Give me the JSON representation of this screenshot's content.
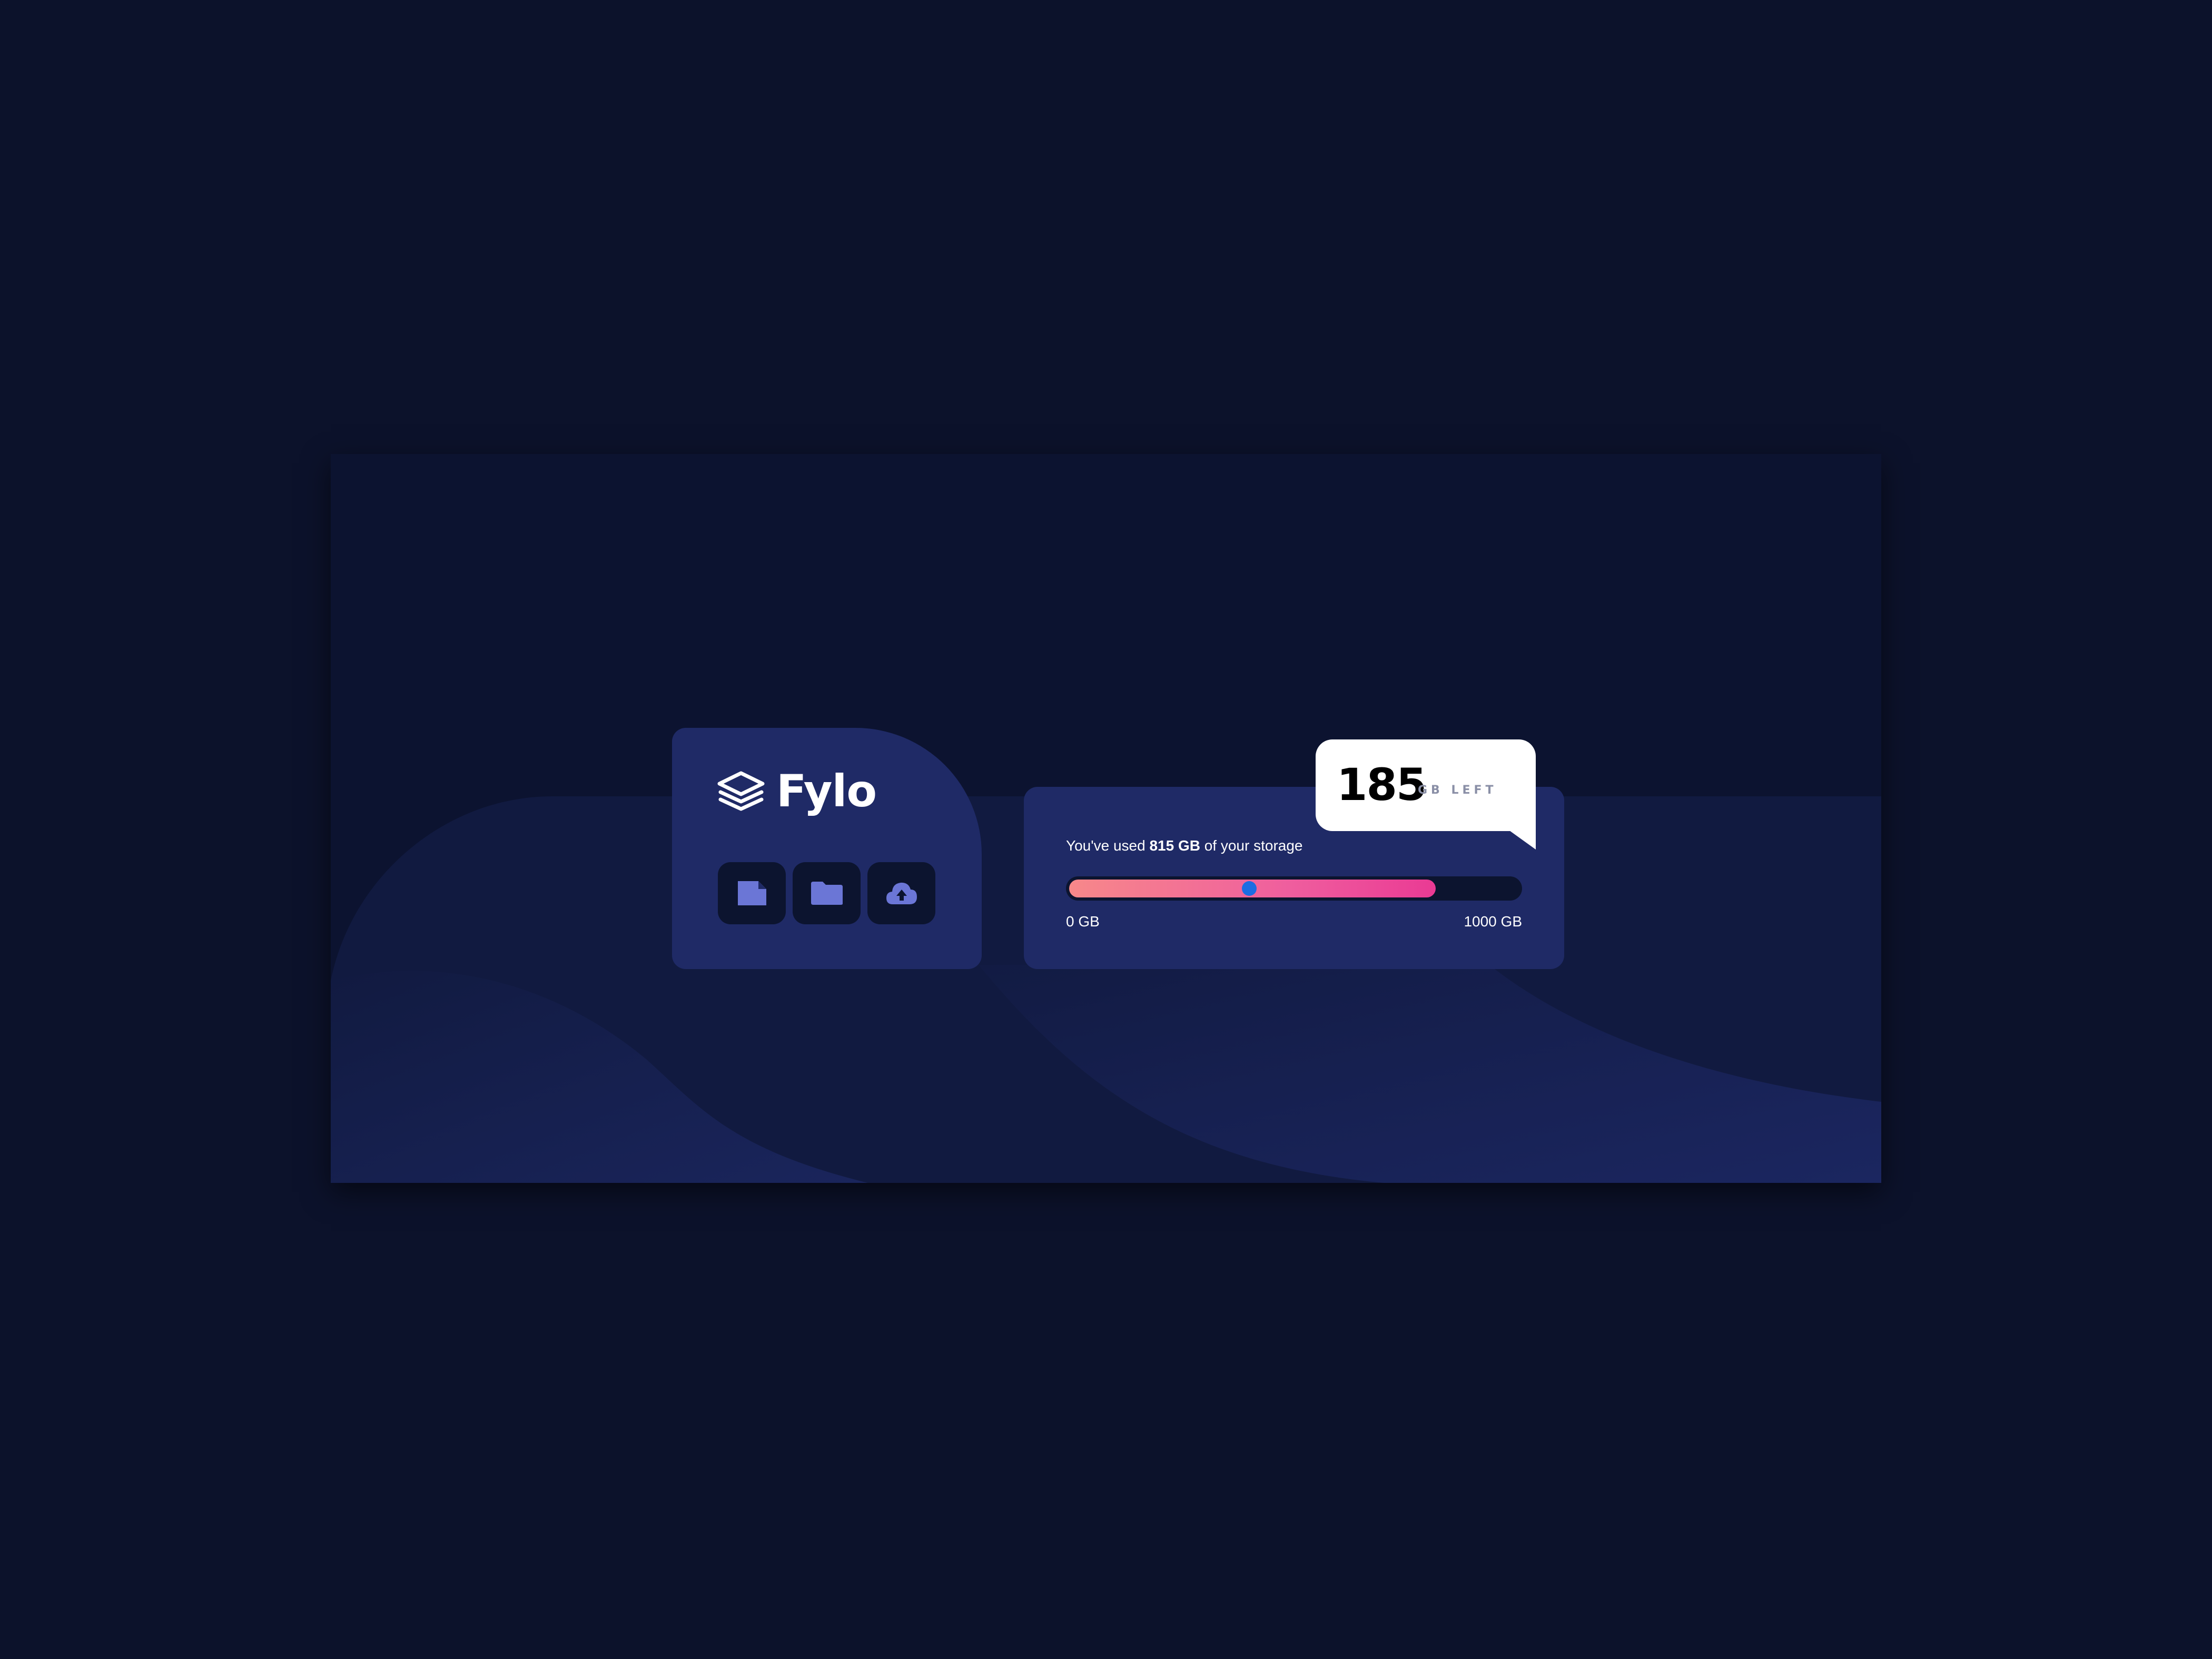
{
  "brand": {
    "name": "Fylo"
  },
  "toolbar": {
    "buttons": [
      {
        "icon": "document-icon"
      },
      {
        "icon": "folder-icon"
      },
      {
        "icon": "cloud-upload-icon"
      }
    ]
  },
  "storage": {
    "usage_prefix": "You've used ",
    "used_amount": "815 GB",
    "usage_suffix": " of your storage",
    "used_fraction": 0.815,
    "slider_position": 0.4,
    "range_min": "0 GB",
    "range_max": "1000 GB"
  },
  "remaining": {
    "value": "185",
    "unit_label": "GB LEFT"
  },
  "colors": {
    "page_background": "#0c122b",
    "card_background": "#1f2a66",
    "icon_color": "#6b76d6",
    "bar_gradient_start": "#f7888a",
    "bar_gradient_end": "#ea3a94",
    "knob": "#1d6de2"
  }
}
